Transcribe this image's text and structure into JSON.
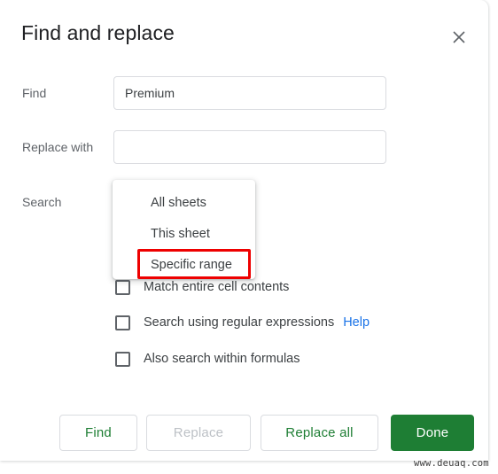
{
  "dialog": {
    "title": "Find and replace",
    "close_icon": "close-icon"
  },
  "fields": {
    "find": {
      "label": "Find",
      "value": "Premium",
      "placeholder": ""
    },
    "replace": {
      "label": "Replace with",
      "value": "",
      "placeholder": ""
    },
    "search": {
      "label": "Search",
      "selected": "All sheets",
      "options": [
        "All sheets",
        "This sheet",
        "Specific range"
      ]
    }
  },
  "menu": {
    "items": [
      {
        "label": "All sheets",
        "highlighted": false
      },
      {
        "label": "This sheet",
        "highlighted": false
      },
      {
        "label": "Specific range",
        "highlighted": true
      }
    ]
  },
  "checkboxes": [
    {
      "label": "Match entire cell contents",
      "checked": false,
      "help": ""
    },
    {
      "label": "Search using regular expressions",
      "checked": false,
      "help": "Help"
    },
    {
      "label": "Also search within formulas",
      "checked": false,
      "help": ""
    }
  ],
  "buttons": {
    "find": "Find",
    "replace": "Replace",
    "replace_all": "Replace all",
    "done": "Done"
  },
  "colors": {
    "accent_green": "#1e7e34",
    "link_blue": "#1a73e8",
    "highlight_red": "#ee0000",
    "disabled_gray": "#bdc1c6"
  },
  "watermark": "www.deuaq.com"
}
